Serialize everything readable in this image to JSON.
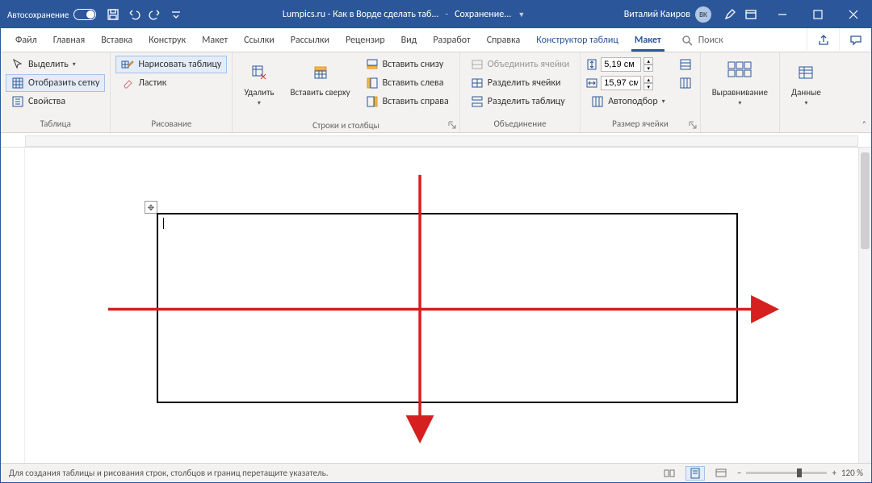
{
  "titlebar": {
    "autosave_label": "Автосохранение",
    "document_title": "Lumpics.ru - Как в Ворде сделать таб...",
    "saving_label": "Сохранение...",
    "user_name": "Виталий Каиров",
    "user_initials": "ВК"
  },
  "tabs": {
    "file": "Файл",
    "home": "Главная",
    "insert": "Вставка",
    "design": "Конструк",
    "layout": "Макет",
    "references": "Ссылки",
    "mailings": "Рассылки",
    "review": "Рецензир",
    "view": "Вид",
    "developer": "Разработ",
    "help": "Справка",
    "table_design": "Конструктор таблиц",
    "table_layout": "Макет",
    "search_placeholder": "Поиск"
  },
  "ribbon": {
    "table": {
      "group_label": "Таблица",
      "select": "Выделить",
      "gridlines": "Отобразить сетку",
      "properties": "Свойства"
    },
    "draw": {
      "group_label": "Рисование",
      "draw_table": "Нарисовать таблицу",
      "eraser": "Ластик"
    },
    "rowscols": {
      "group_label": "Строки и столбцы",
      "delete": "Удалить",
      "insert_above": "Вставить сверху",
      "insert_below": "Вставить снизу",
      "insert_left": "Вставить слева",
      "insert_right": "Вставить справа"
    },
    "merge": {
      "group_label": "Объединение",
      "merge_cells": "Объединить ячейки",
      "split_cells": "Разделить ячейки",
      "split_table": "Разделить таблицу"
    },
    "size": {
      "group_label": "Размер ячейки",
      "row_height": "5,19 см",
      "col_width": "15,97 см",
      "autofit": "Автоподбор"
    },
    "align": {
      "group_label": "Выравнивание"
    },
    "data": {
      "group_label": "Данные"
    }
  },
  "statusbar": {
    "hint": "Для создания таблицы и рисования строк, столбцов и границ перетащите указатель.",
    "zoom": "120 %"
  }
}
